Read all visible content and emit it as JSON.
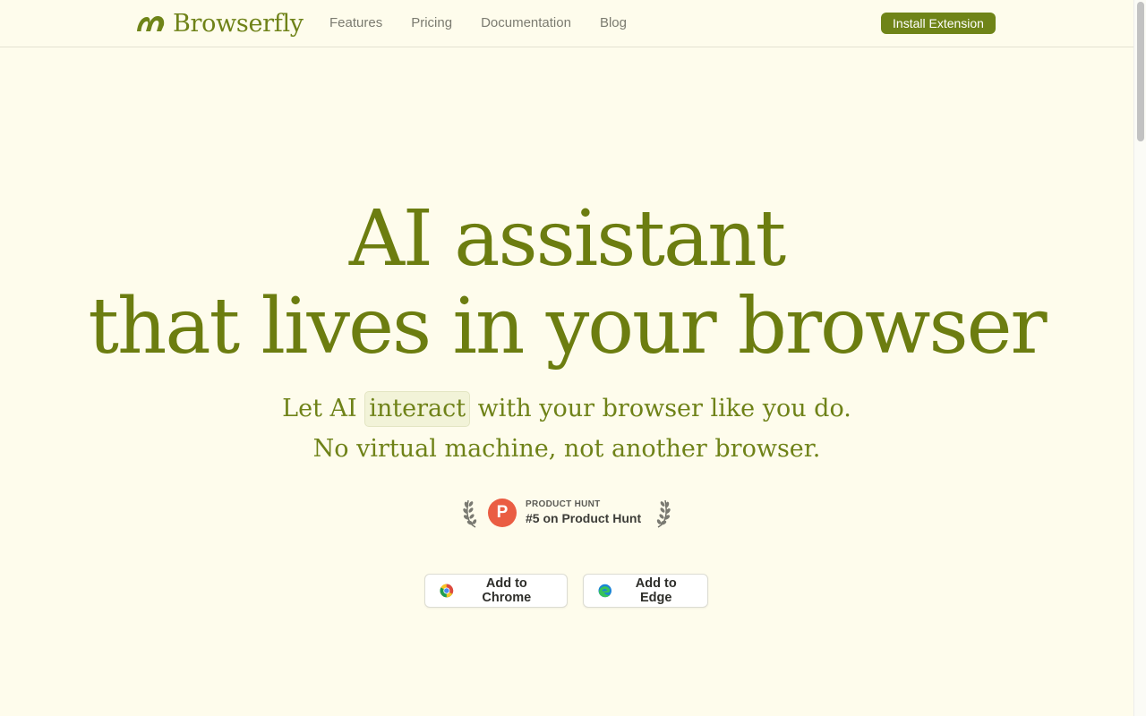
{
  "header": {
    "brand": "Browserfly",
    "nav": [
      "Features",
      "Pricing",
      "Documentation",
      "Blog"
    ],
    "install_label": "Install Extension"
  },
  "hero": {
    "title_line1": "AI assistant",
    "title_line2": "that lives in your browser",
    "sub_pre": "Let AI ",
    "sub_highlight": "interact",
    "sub_post": " with your browser like you do.",
    "sub_line2": "No virtual machine, not another browser."
  },
  "badge": {
    "logo_letter": "P",
    "small": "PRODUCT HUNT",
    "big": "#5 on Product Hunt"
  },
  "cta": {
    "chrome_label": "Add to Chrome",
    "edge_label": "Add to Edge"
  },
  "colors": {
    "background": "#fefcec",
    "accent": "#6f8418",
    "product_hunt": "#ea5d43"
  },
  "icons": {
    "logo": "browserfly-logo-icon",
    "laurel": "laurel-icon",
    "chrome": "chrome-icon",
    "edge": "edge-icon"
  }
}
